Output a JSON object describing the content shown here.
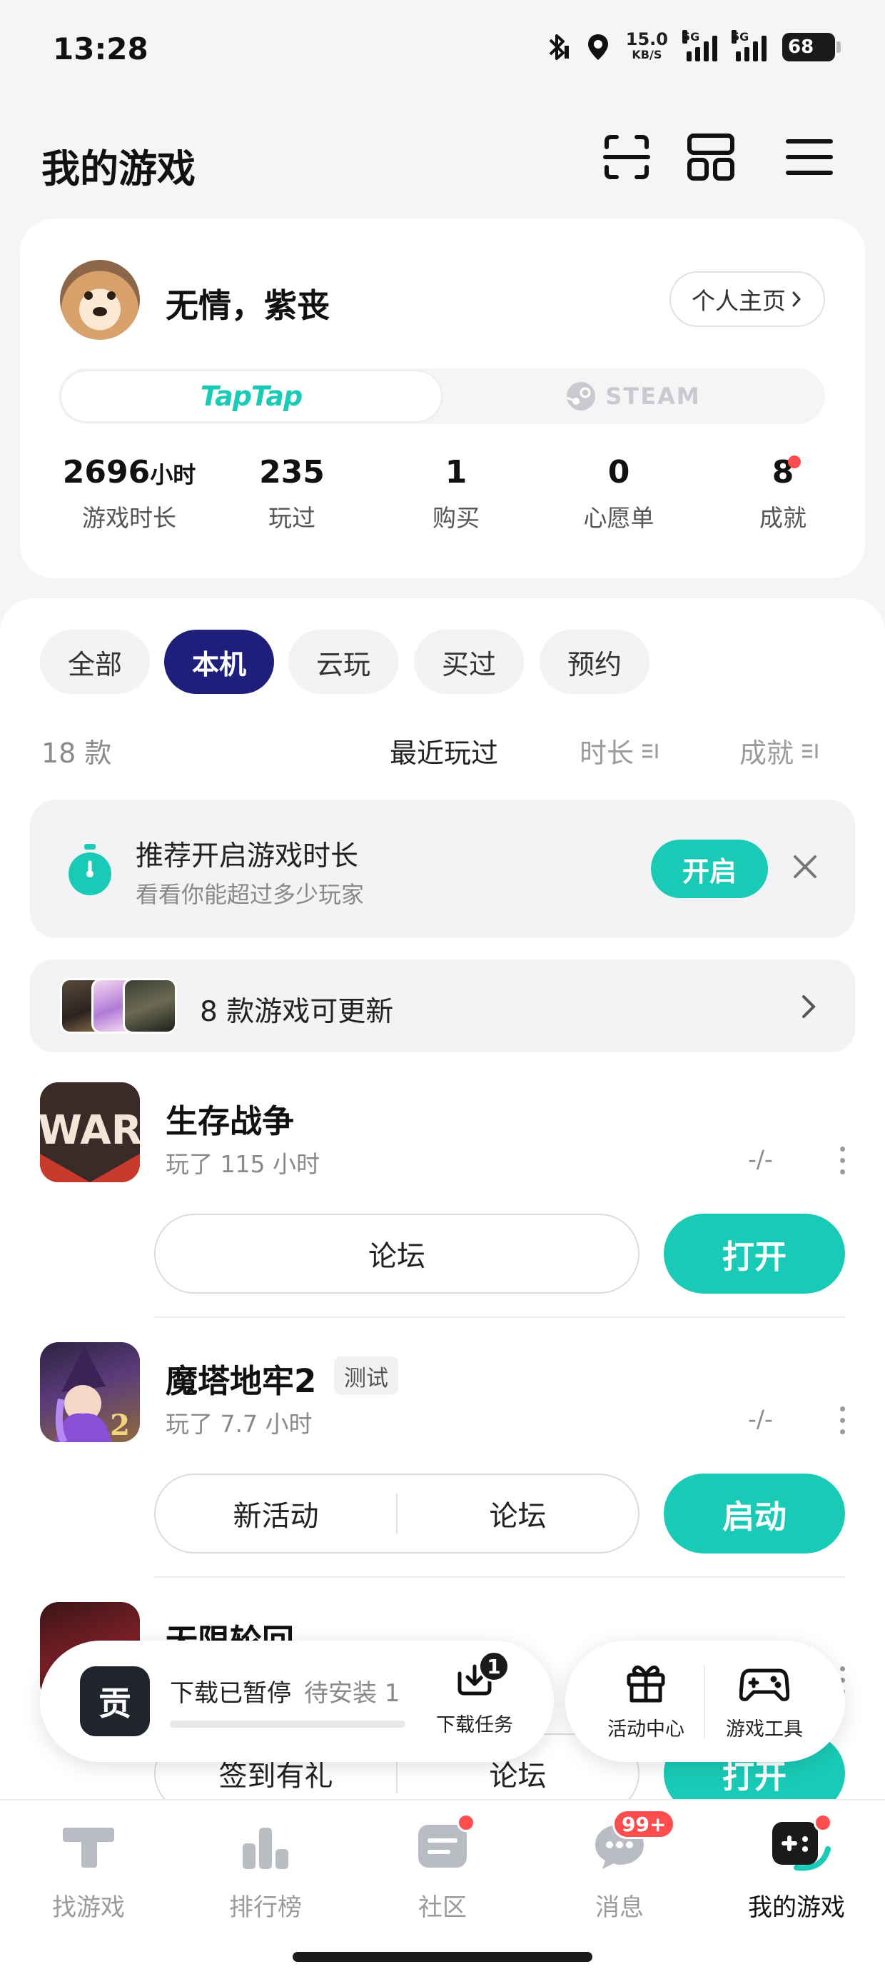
{
  "status_bar": {
    "time": "13:28",
    "net_speed_value": "15.0",
    "net_speed_unit": "KB/S",
    "sim1_label": "5G",
    "sim2_label": "5G",
    "battery_level": "68"
  },
  "header": {
    "title": "我的游戏",
    "icons": [
      "scan-icon",
      "grid-icon",
      "menu-icon"
    ]
  },
  "profile": {
    "username": "无情，紫丧",
    "home_button_label": "个人主页",
    "platforms": {
      "active": "TapTap",
      "inactive": "STEAM"
    },
    "stats": [
      {
        "value": "2696",
        "unit": "小时",
        "label": "游戏时长"
      },
      {
        "value": "235",
        "unit": "",
        "label": "玩过"
      },
      {
        "value": "1",
        "unit": "",
        "label": "购买"
      },
      {
        "value": "0",
        "unit": "",
        "label": "心愿单"
      },
      {
        "value": "8",
        "unit": "",
        "label": "成就",
        "has_red_dot": true
      }
    ]
  },
  "filters": {
    "chips": [
      "全部",
      "本机",
      "云玩",
      "买过",
      "预约"
    ],
    "active": "本机"
  },
  "sort": {
    "count_label": "18 款",
    "options": [
      "最近玩过",
      "时长",
      "成就"
    ],
    "active": "最近玩过"
  },
  "banner": {
    "title": "推荐开启游戏时长",
    "subtitle": "看看你能超过多少玩家",
    "button_label": "开启"
  },
  "updates": {
    "text": "8 款游戏可更新"
  },
  "games": [
    {
      "name": "生存战争",
      "badge": "",
      "playtime": "玩了 115 小时",
      "dash": "-/-",
      "secondary_actions": [
        "论坛"
      ],
      "primary_action": "打开",
      "icon": "war-game-icon"
    },
    {
      "name": "魔塔地牢2",
      "badge": "测试",
      "playtime": "玩了 7.7 小时",
      "dash": "-/-",
      "secondary_actions": [
        "新活动",
        "论坛"
      ],
      "primary_action": "启动",
      "icon": "witch-game-icon"
    },
    {
      "name": "无限轮回",
      "badge": "",
      "playtime": "",
      "dash": "",
      "secondary_actions": [
        "签到有礼",
        "论坛"
      ],
      "primary_action": "打开",
      "icon": "dark-game-icon"
    }
  ],
  "download_bar": {
    "app_glyph": "贡",
    "status": "下载已暂停",
    "pending": "待安装 1",
    "task_label": "下载任务",
    "task_count": "1"
  },
  "tools": [
    {
      "label": "活动中心",
      "icon": "gift-icon"
    },
    {
      "label": "游戏工具",
      "icon": "gamepad-icon"
    }
  ],
  "bottom_nav": {
    "items": [
      {
        "label": "找游戏",
        "icon": "taptap-icon"
      },
      {
        "label": "排行榜",
        "icon": "ranking-icon"
      },
      {
        "label": "社区",
        "icon": "community-icon",
        "red_dot": true
      },
      {
        "label": "消息",
        "icon": "message-icon",
        "badge": "99+"
      },
      {
        "label": "我的游戏",
        "icon": "my-games-icon",
        "red_dot": true
      }
    ],
    "active": "我的游戏"
  },
  "colors": {
    "accent": "#19cbb7",
    "active_chip": "#1e1f7c",
    "notification": "#ff4d4f"
  }
}
